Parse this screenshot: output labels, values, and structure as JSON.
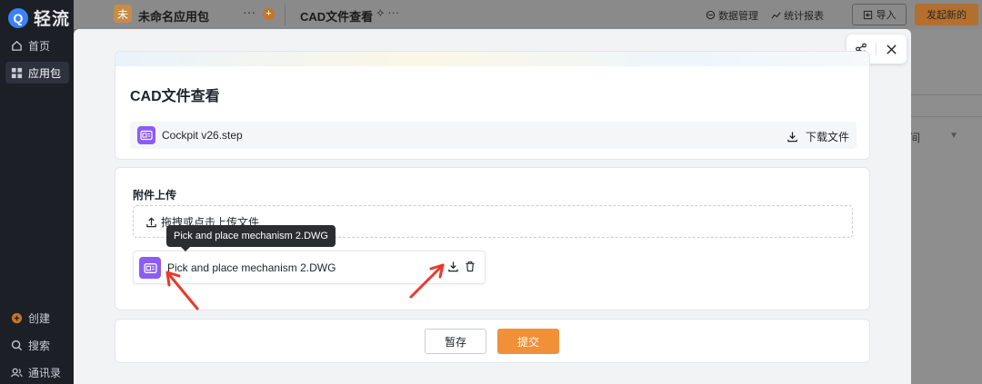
{
  "sidebar": {
    "logo_mark": "Q",
    "logo_text": "轻流",
    "items": [
      {
        "label": "首页",
        "icon": "home-icon"
      },
      {
        "label": "应用包",
        "icon": "grid-icon"
      },
      {
        "label": "创建",
        "icon": "plus-circle-icon"
      },
      {
        "label": "搜索",
        "icon": "search-icon"
      },
      {
        "label": "通讯录",
        "icon": "contacts-icon"
      }
    ]
  },
  "topbar": {
    "app_badge": "未",
    "app_name": "未命名应用包",
    "more": "···",
    "add": "+",
    "page_name": "CAD文件查看",
    "page_tools": "⟡ ···",
    "data_manage": "数据管理",
    "reports": "统计报表",
    "import": "导入",
    "publish": "发起新的"
  },
  "background": {
    "right_text": "间"
  },
  "modal": {
    "title": "CAD文件查看",
    "file_name": "Cockpit v26.step",
    "download_label": "下载文件",
    "attachment_label": "附件上传",
    "dropzone_text": "拖拽或点击上传文件",
    "attachment_name": "Pick and place mechanism 2.DWG",
    "tooltip": "Pick and place mechanism 2.DWG",
    "save_label": "暂存",
    "submit_label": "提交"
  },
  "colors": {
    "accent": "#f0913a",
    "file_icon": "#8b5cf6",
    "annotation_arrow": "#e8392b",
    "sidebar_bg": "#1c1f26"
  }
}
